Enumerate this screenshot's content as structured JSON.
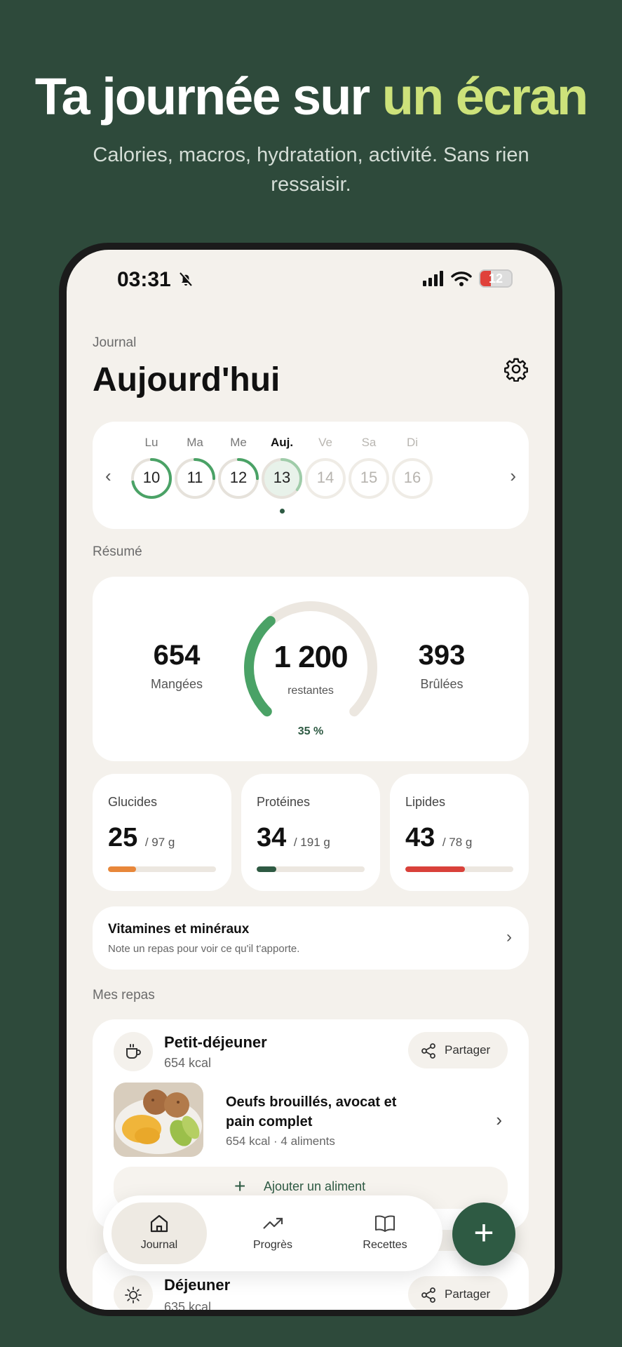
{
  "promo": {
    "headline_main": "Ta journée sur ",
    "headline_accent": "un écran",
    "subline": "Calories, macros, hydratation, activité. Sans rien ressaisir."
  },
  "status": {
    "time": "03:31",
    "battery": "12"
  },
  "header": {
    "overline": "Journal",
    "title": "Aujourd'hui"
  },
  "week": {
    "days": [
      {
        "label": "Lu",
        "num": "10",
        "progress": 0.72,
        "state": "past"
      },
      {
        "label": "Ma",
        "num": "11",
        "progress": 0.25,
        "state": "past"
      },
      {
        "label": "Me",
        "num": "12",
        "progress": 0.25,
        "state": "past"
      },
      {
        "label": "Auj.",
        "num": "13",
        "progress": 0.35,
        "state": "today"
      },
      {
        "label": "Ve",
        "num": "14",
        "progress": 0,
        "state": "future"
      },
      {
        "label": "Sa",
        "num": "15",
        "progress": 0,
        "state": "future"
      },
      {
        "label": "Di",
        "num": "16",
        "progress": 0,
        "state": "future"
      }
    ]
  },
  "summary": {
    "label": "Résumé",
    "eaten_value": "654",
    "eaten_label": "Mangées",
    "remaining_value": "1 200",
    "remaining_label": "restantes",
    "percent_label": "35 %",
    "percent": 0.35,
    "burned_value": "393",
    "burned_label": "Brûlées"
  },
  "macros": [
    {
      "name": "Glucides",
      "value": "25",
      "unit": "/ 97 g",
      "fraction": 0.26,
      "color": "#e8873a"
    },
    {
      "name": "Protéines",
      "value": "34",
      "unit": "/ 191 g",
      "fraction": 0.18,
      "color": "#2e5a43"
    },
    {
      "name": "Lipides",
      "value": "43",
      "unit": "/ 78 g",
      "fraction": 0.55,
      "color": "#d9413a"
    }
  ],
  "vitamins": {
    "title": "Vitamines et minéraux",
    "subtitle": "Note un repas pour voir ce qu'il t'apporte."
  },
  "meals": {
    "label": "Mes repas",
    "breakfast": {
      "name": "Petit-déjeuner",
      "kcal": "654 kcal",
      "share": "Partager",
      "food_title": "Oeufs brouillés, avocat et pain complet",
      "food_sub": "654 kcal · 4 aliments",
      "add_label": "Ajouter un aliment"
    },
    "lunch": {
      "name": "Déjeuner",
      "kcal": "635 kcal",
      "share": "Partager"
    }
  },
  "tabs": [
    {
      "label": "Journal",
      "active": true
    },
    {
      "label": "Progrès",
      "active": false
    },
    {
      "label": "Recettes",
      "active": false
    }
  ]
}
